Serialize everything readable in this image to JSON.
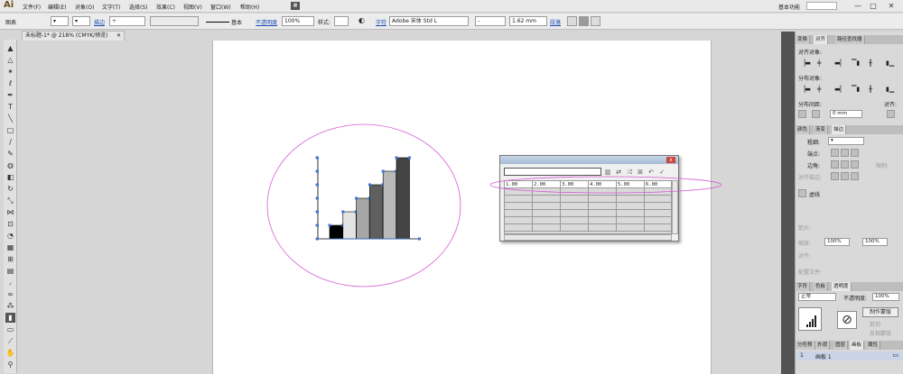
{
  "app": {
    "logo": "Ai",
    "workspace": "基本功能",
    "window_min": "—",
    "window_max": "□",
    "window_close": "✕",
    "workspace_icon": "ai-bridge-icon"
  },
  "menu": [
    "文件(F)",
    "编辑(E)",
    "对象(O)",
    "文字(T)",
    "选择(S)",
    "效果(C)",
    "视图(V)",
    "窗口(W)",
    "帮助(H)"
  ],
  "control": {
    "object_type": "图表",
    "stroke_label": "描边",
    "line_style": "基本",
    "opacity_label": "不透明度",
    "opacity_value": "100%",
    "style_label": "样式:",
    "char_label": "字符",
    "font": "Adobe 宋体 Std L",
    "font_style": "-",
    "font_size": "1.62 mm",
    "para_label": "段落"
  },
  "document": {
    "tab_title": "未标题-1* @ 218% (CMYK/预览)",
    "tab_close": "✕"
  },
  "chart_data": {
    "type": "bar",
    "values": [
      1.0,
      2.0,
      3.0,
      4.0,
      5.0,
      6.0
    ],
    "ylim": [
      0,
      6
    ],
    "colors": [
      "#000000",
      "#e3e3e3",
      "#a6a6a6",
      "#5f5f5f",
      "#b9b9b9",
      "#444444"
    ]
  },
  "graph_data": {
    "cells": [
      "1.00",
      "2.00",
      "3.00",
      "4.00",
      "5.00",
      "6.00"
    ],
    "close": "x"
  },
  "panels": {
    "top_tabs": [
      "变换",
      "对齐",
      "路径查找器"
    ],
    "align_objects": "对齐对象:",
    "distribute_objects": "分布对象:",
    "distribute_spacing": "分布间距:",
    "align_to": "对齐:",
    "spacing_value": "0 mm",
    "stroke_tabs": [
      "颜色",
      "渐变",
      "描边"
    ],
    "weight_label": "粗细:",
    "cap_label": "端点:",
    "corner_label": "边角:",
    "limit_label": "限制:",
    "align_stroke_label": "对齐描边:",
    "dashed_label": "虚线",
    "arrow_label": "箭头:",
    "scale_label": "缩放:",
    "align2_label": "对齐:",
    "profile_label": "配置文件:",
    "scale_a": "100%",
    "scale_b": "100%",
    "trans_tabs": [
      "字符",
      "色板",
      "透明度"
    ],
    "blend_mode": "正常",
    "opacity_label": "不透明度:",
    "opacity_value": "100%",
    "make_mask": "制作蒙版",
    "clip": "剪切",
    "invert_mask": "反相蒙版",
    "layer_tabs": [
      "分色预",
      "外观",
      "图层",
      "画板",
      "属性"
    ],
    "artboard_num": "1",
    "artboard_name": "画板 1"
  }
}
